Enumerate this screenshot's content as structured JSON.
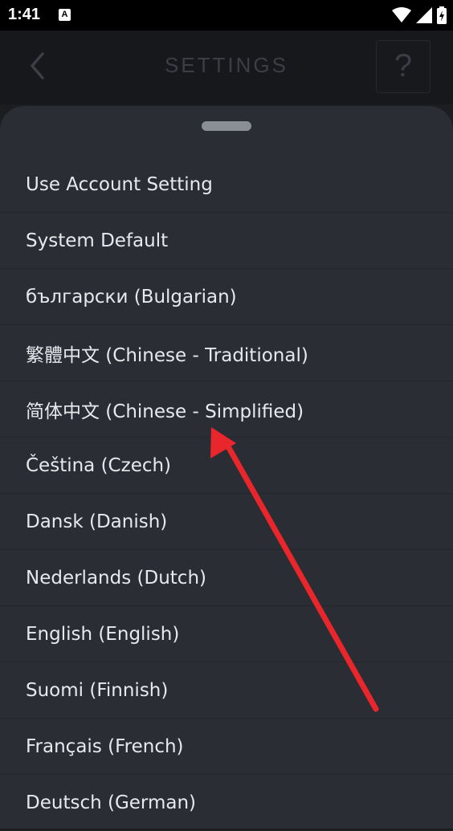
{
  "status_bar": {
    "time": "1:41",
    "notification_icon_text": "A",
    "icons": [
      "wifi-icon",
      "signal-icon",
      "battery-charging-icon"
    ]
  },
  "header": {
    "title": "SETTINGS",
    "back_icon": "chevron-left-icon",
    "help_label": "?"
  },
  "language_sheet": {
    "items": [
      "Use Account Setting",
      "System Default",
      "български (Bulgarian)",
      "繁體中文 (Chinese - Traditional)",
      "简体中文 (Chinese - Simplified)",
      "Čeština (Czech)",
      "Dansk (Danish)",
      "Nederlands (Dutch)",
      "English (English)",
      "Suomi (Finnish)",
      "Français (French)",
      "Deutsch (German)"
    ]
  },
  "colors": {
    "sheet_background": "#2a2d34",
    "header_background": "#16181c",
    "annotation_arrow": "#e8262b"
  }
}
